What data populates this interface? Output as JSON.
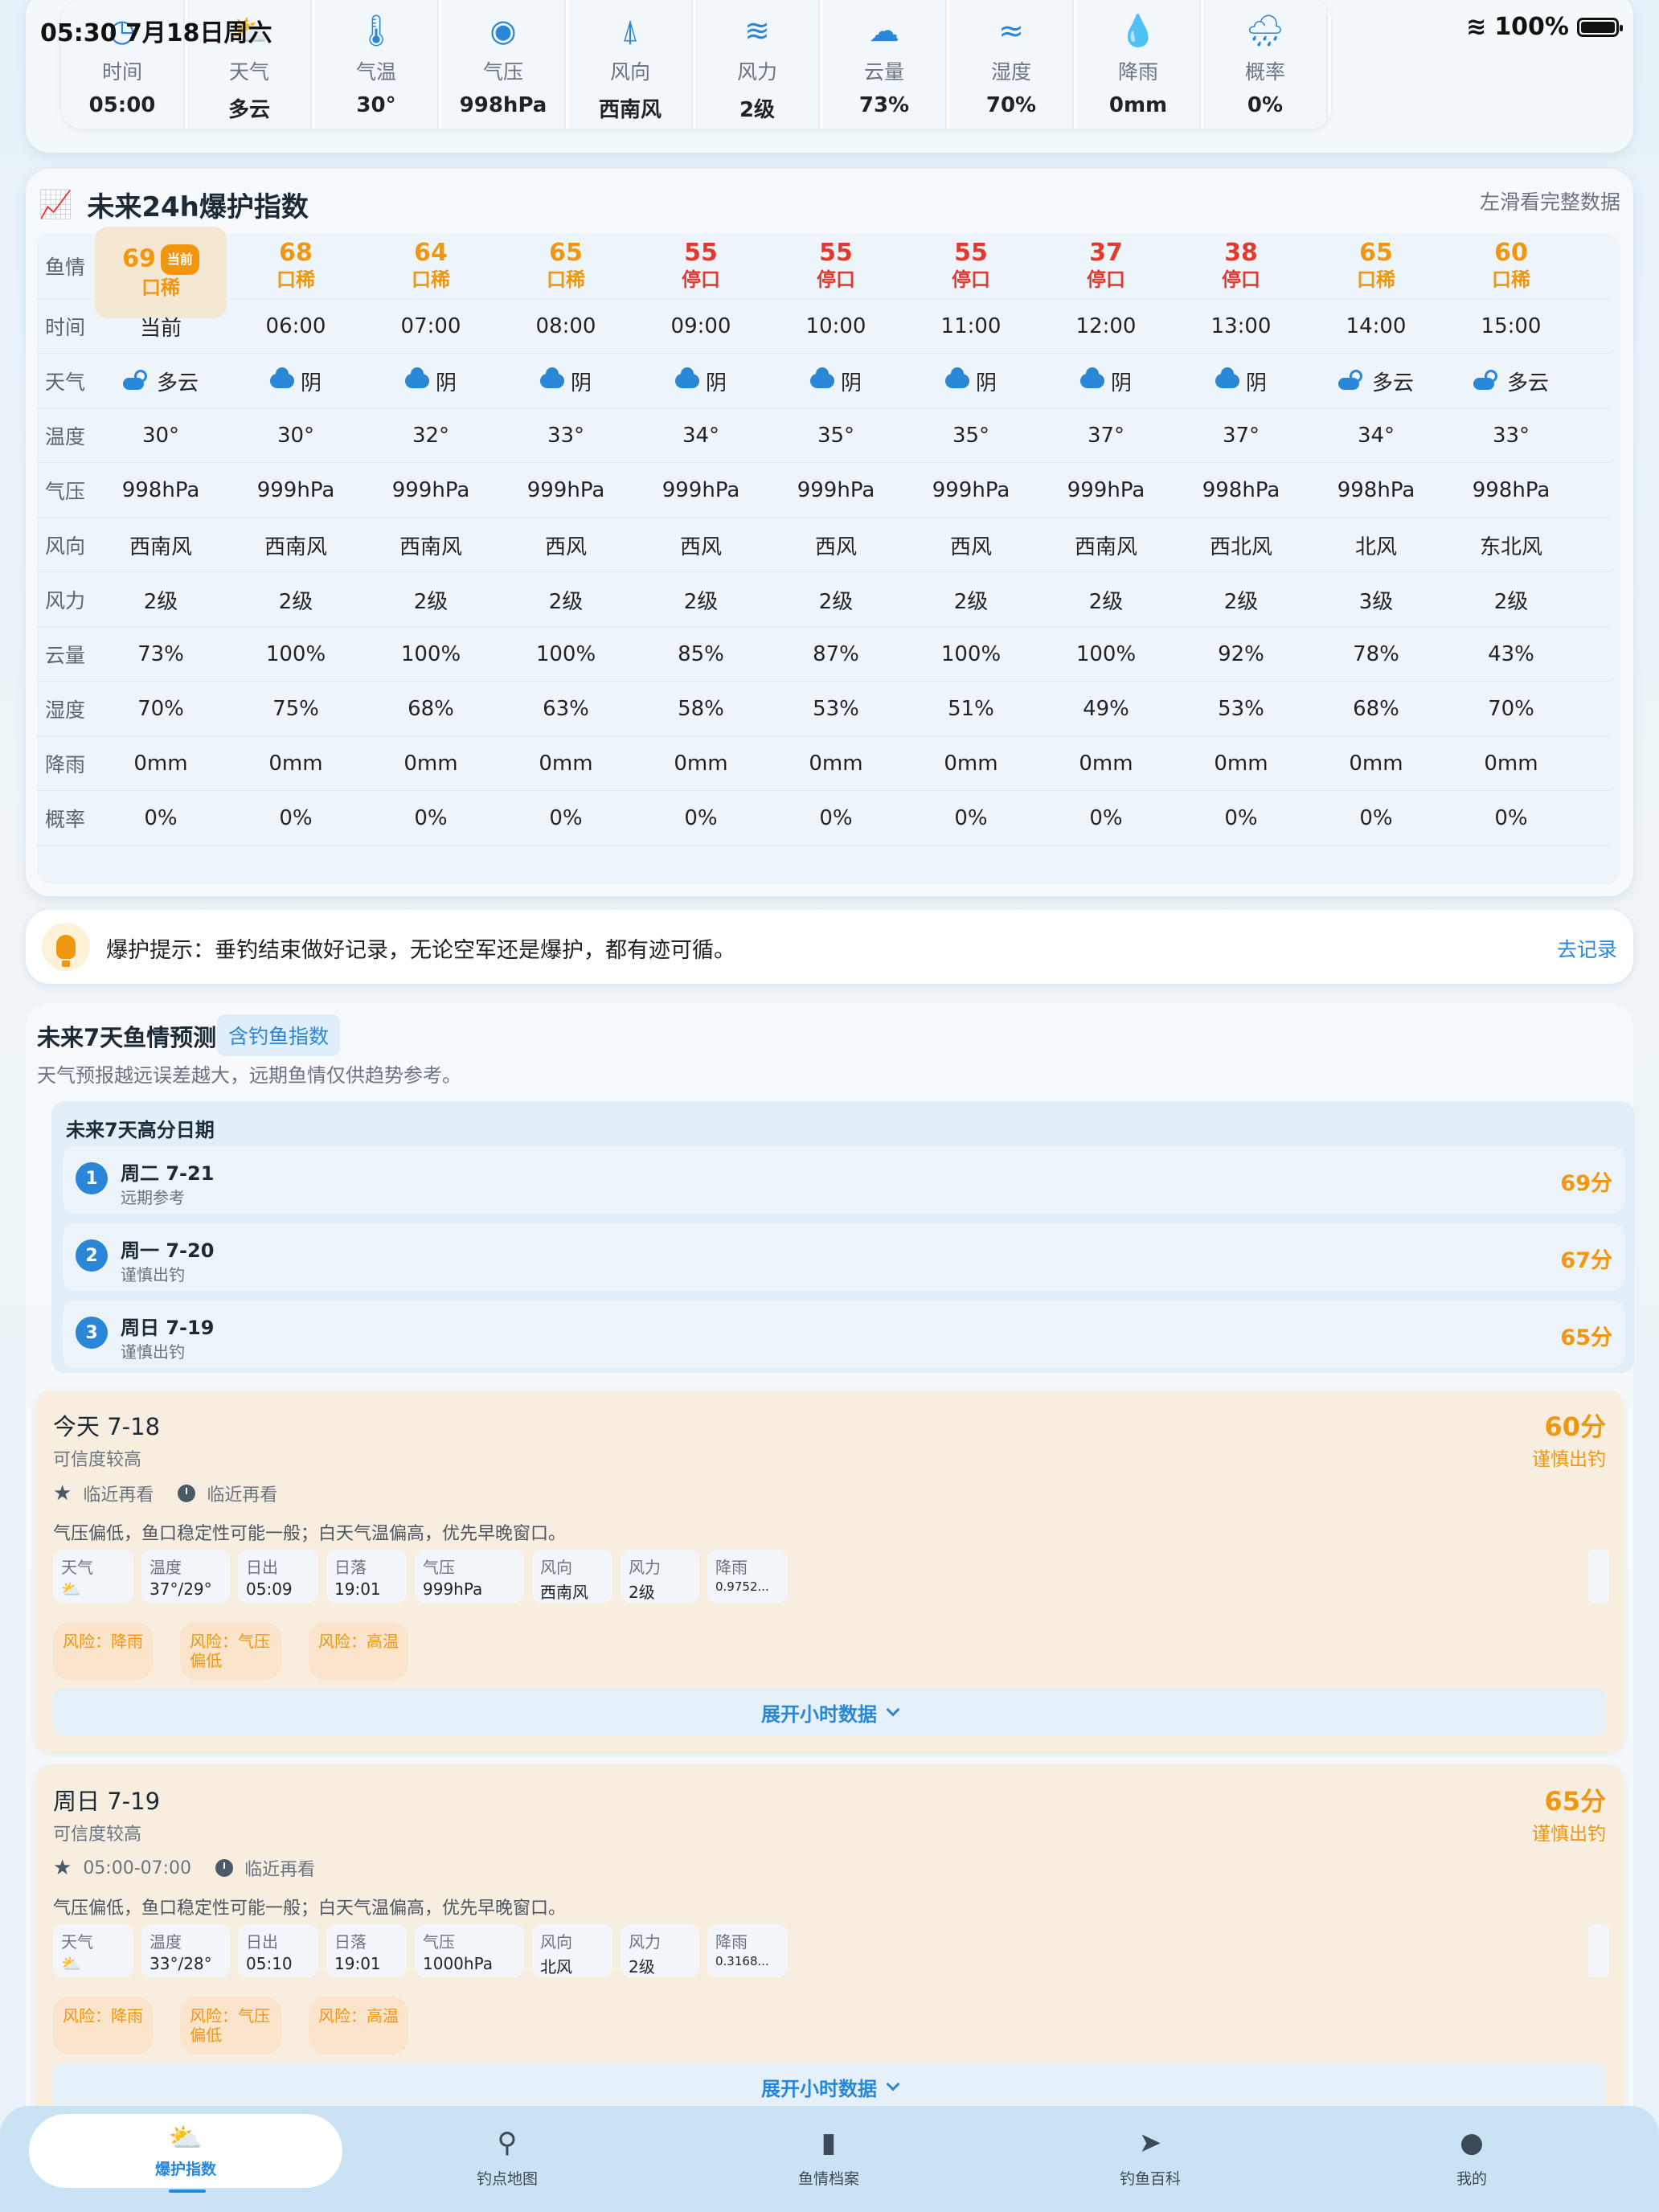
{
  "status_bar": {
    "time_date": "05:30   7月18日周六",
    "battery": "100%"
  },
  "current": [
    {
      "icon": "clock-icon",
      "label": "时间",
      "value": "05:00"
    },
    {
      "icon": "partly-cloudy-icon",
      "label": "天气",
      "value": "多云"
    },
    {
      "icon": "thermometer-icon",
      "label": "气温",
      "value": "30°"
    },
    {
      "icon": "gauge-icon",
      "label": "气压",
      "value": "998hPa"
    },
    {
      "icon": "wind-direction-icon",
      "label": "风向",
      "value": "西南风"
    },
    {
      "icon": "wind-icon",
      "label": "风力",
      "value": "2级"
    },
    {
      "icon": "cloud-icon",
      "label": "云量",
      "value": "73%"
    },
    {
      "icon": "humidity-icon",
      "label": "湿度",
      "value": "70%"
    },
    {
      "icon": "rain-drop-icon",
      "label": "降雨",
      "value": "0mm"
    },
    {
      "icon": "rain-cloud-icon",
      "label": "概率",
      "value": "0%"
    }
  ],
  "forecast24": {
    "title": "未来24h爆护指数",
    "hint": "左滑看完整数据",
    "row_labels": {
      "fish": "鱼情",
      "time": "时间",
      "weather": "天气",
      "temp": "温度",
      "pressure": "气压",
      "wind_dir": "风向",
      "wind": "风力",
      "cloud": "云量",
      "humidity": "湿度",
      "rain": "降雨",
      "prob": "概率"
    },
    "current_badge": "当前",
    "columns": [
      {
        "score": "69",
        "status": "口稀",
        "level": "orange",
        "time": "当前",
        "weather": "多云",
        "wx": "partly",
        "temp": "30°",
        "pressure": "998hPa",
        "wind_dir": "西南风",
        "wind": "2级",
        "cloud": "73%",
        "humidity": "70%",
        "rain": "0mm",
        "prob": "0%"
      },
      {
        "score": "68",
        "status": "口稀",
        "level": "orange",
        "time": "06:00",
        "weather": "阴",
        "wx": "cloud",
        "temp": "30°",
        "pressure": "999hPa",
        "wind_dir": "西南风",
        "wind": "2级",
        "cloud": "100%",
        "humidity": "75%",
        "rain": "0mm",
        "prob": "0%"
      },
      {
        "score": "64",
        "status": "口稀",
        "level": "orange",
        "time": "07:00",
        "weather": "阴",
        "wx": "cloud",
        "temp": "32°",
        "pressure": "999hPa",
        "wind_dir": "西南风",
        "wind": "2级",
        "cloud": "100%",
        "humidity": "68%",
        "rain": "0mm",
        "prob": "0%"
      },
      {
        "score": "65",
        "status": "口稀",
        "level": "orange",
        "time": "08:00",
        "weather": "阴",
        "wx": "cloud",
        "temp": "33°",
        "pressure": "999hPa",
        "wind_dir": "西风",
        "wind": "2级",
        "cloud": "100%",
        "humidity": "63%",
        "rain": "0mm",
        "prob": "0%"
      },
      {
        "score": "55",
        "status": "停口",
        "level": "red",
        "time": "09:00",
        "weather": "阴",
        "wx": "cloud",
        "temp": "34°",
        "pressure": "999hPa",
        "wind_dir": "西风",
        "wind": "2级",
        "cloud": "85%",
        "humidity": "58%",
        "rain": "0mm",
        "prob": "0%"
      },
      {
        "score": "55",
        "status": "停口",
        "level": "red",
        "time": "10:00",
        "weather": "阴",
        "wx": "cloud",
        "temp": "35°",
        "pressure": "999hPa",
        "wind_dir": "西风",
        "wind": "2级",
        "cloud": "87%",
        "humidity": "53%",
        "rain": "0mm",
        "prob": "0%"
      },
      {
        "score": "55",
        "status": "停口",
        "level": "red",
        "time": "11:00",
        "weather": "阴",
        "wx": "cloud",
        "temp": "35°",
        "pressure": "999hPa",
        "wind_dir": "西风",
        "wind": "2级",
        "cloud": "100%",
        "humidity": "51%",
        "rain": "0mm",
        "prob": "0%"
      },
      {
        "score": "37",
        "status": "停口",
        "level": "red",
        "time": "12:00",
        "weather": "阴",
        "wx": "cloud",
        "temp": "37°",
        "pressure": "999hPa",
        "wind_dir": "西南风",
        "wind": "2级",
        "cloud": "100%",
        "humidity": "49%",
        "rain": "0mm",
        "prob": "0%"
      },
      {
        "score": "38",
        "status": "停口",
        "level": "red",
        "time": "13:00",
        "weather": "阴",
        "wx": "cloud",
        "temp": "37°",
        "pressure": "998hPa",
        "wind_dir": "西北风",
        "wind": "2级",
        "cloud": "92%",
        "humidity": "53%",
        "rain": "0mm",
        "prob": "0%"
      },
      {
        "score": "65",
        "status": "口稀",
        "level": "orange",
        "time": "14:00",
        "weather": "多云",
        "wx": "partly",
        "temp": "34°",
        "pressure": "998hPa",
        "wind_dir": "北风",
        "wind": "3级",
        "cloud": "78%",
        "humidity": "68%",
        "rain": "0mm",
        "prob": "0%"
      },
      {
        "score": "60",
        "status": "口稀",
        "level": "orange",
        "time": "15:00",
        "weather": "多云",
        "wx": "partly",
        "temp": "33°",
        "pressure": "998hPa",
        "wind_dir": "东北风",
        "wind": "2级",
        "cloud": "43%",
        "humidity": "70%",
        "rain": "0mm",
        "prob": "0%"
      }
    ]
  },
  "tip": {
    "text": "爆护提示：垂钓结束做好记录，无论空军还是爆护，都有迹可循。",
    "link": "去记录"
  },
  "week": {
    "title": "未来7天鱼情预测",
    "badge": "含钓鱼指数",
    "subtitle": "天气预报越远误差越大，远期鱼情仅供趋势参考。",
    "top_title": "未来7天高分日期",
    "top": [
      {
        "rank": "1",
        "date": "周二 7-21",
        "note": "远期参考",
        "score": "69分"
      },
      {
        "rank": "2",
        "date": "周一 7-20",
        "note": "谨慎出钓",
        "score": "67分"
      },
      {
        "rank": "3",
        "date": "周日 7-19",
        "note": "谨慎出钓",
        "score": "65分"
      }
    ],
    "days": [
      {
        "date": "今天 7-18",
        "reliability": "可信度较高",
        "score": "60分",
        "status": "谨慎出钓",
        "best_time": "临近再看",
        "watch_time": "临近再看",
        "note": "气压偏低，鱼口稳定性可能一般；白天气温偏高，优先早晚窗口。",
        "pills": [
          {
            "label": "天气",
            "value": "⛅"
          },
          {
            "label": "温度",
            "value": "37°/29°"
          },
          {
            "label": "日出",
            "value": "05:09"
          },
          {
            "label": "日落",
            "value": "19:01"
          },
          {
            "label": "气压",
            "value": "999hPa"
          },
          {
            "label": "风向",
            "value": "西南风"
          },
          {
            "label": "风力",
            "value": "2级"
          },
          {
            "label": "降雨",
            "value": "0.9752..."
          }
        ],
        "risks": [
          "风险：降雨",
          "风险：气压偏低",
          "风险：高温"
        ],
        "expand": "展开小时数据"
      },
      {
        "date": "周日 7-19",
        "reliability": "可信度较高",
        "score": "65分",
        "status": "谨慎出钓",
        "best_time": "05:00-07:00",
        "watch_time": "临近再看",
        "note": "气压偏低，鱼口稳定性可能一般；白天气温偏高，优先早晚窗口。",
        "pills": [
          {
            "label": "天气",
            "value": "⛅"
          },
          {
            "label": "温度",
            "value": "33°/28°"
          },
          {
            "label": "日出",
            "value": "05:10"
          },
          {
            "label": "日落",
            "value": "19:01"
          },
          {
            "label": "气压",
            "value": "1000hPa"
          },
          {
            "label": "风向",
            "value": "北风"
          },
          {
            "label": "风力",
            "value": "2级"
          },
          {
            "label": "降雨",
            "value": "0.3168..."
          }
        ],
        "risks": [
          "风险：降雨",
          "风险：气压偏低",
          "风险：高温"
        ],
        "expand": "展开小时数据"
      }
    ]
  },
  "tabs": [
    {
      "label": "爆护指数",
      "icon": "weather-icon",
      "glyph": "⛅",
      "active": true
    },
    {
      "label": "钓点地图",
      "icon": "map-pin-icon",
      "glyph": "⚲",
      "active": false
    },
    {
      "label": "鱼情档案",
      "icon": "book-icon",
      "glyph": "▮",
      "active": false
    },
    {
      "label": "钓鱼百科",
      "icon": "fish-icon",
      "glyph": "➤",
      "active": false
    },
    {
      "label": "我的",
      "icon": "user-icon",
      "glyph": "●",
      "active": false
    }
  ],
  "colors": {
    "accent": "#2a86d6",
    "warn": "#f0960f",
    "bad": "#e23b2e"
  }
}
